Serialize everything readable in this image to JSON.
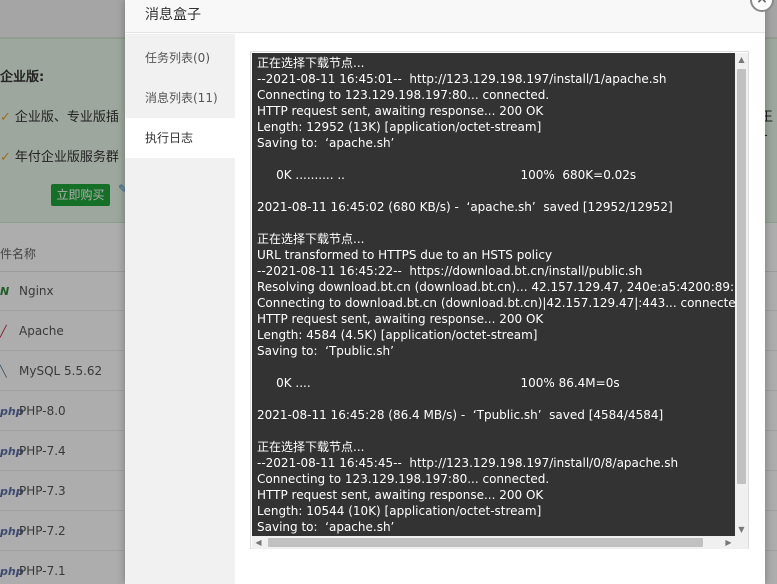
{
  "background": {
    "promo": {
      "title": "企业版:",
      "line1": "企业版、专业版插",
      "line2": "年付企业版服务群",
      "right_fragment": "王1",
      "buy_button": "立即购买"
    },
    "table": {
      "column_header": "件名称",
      "rows": [
        {
          "icon": "nginx-icon",
          "icon_glyph": "N",
          "icon_color": "#2e8b3a",
          "name": "Nginx"
        },
        {
          "icon": "apache-icon",
          "icon_glyph": "╱",
          "icon_color": "#b5223a",
          "name": "Apache"
        },
        {
          "icon": "mysql-icon",
          "icon_glyph": "╲",
          "icon_color": "#5a7f9c",
          "name": "MySQL 5.5.62"
        },
        {
          "icon": "php-icon",
          "icon_glyph": "php",
          "icon_color": "#5a6fa8",
          "name": "PHP-8.0"
        },
        {
          "icon": "php-icon",
          "icon_glyph": "php",
          "icon_color": "#5a6fa8",
          "name": "PHP-7.4"
        },
        {
          "icon": "php-icon",
          "icon_glyph": "php",
          "icon_color": "#5a6fa8",
          "name": "PHP-7.3"
        },
        {
          "icon": "php-icon",
          "icon_glyph": "php",
          "icon_color": "#5a6fa8",
          "name": "PHP-7.2"
        },
        {
          "icon": "php-icon",
          "icon_glyph": "php",
          "icon_color": "#5a6fa8",
          "name": "PHP-7.1"
        }
      ]
    }
  },
  "modal": {
    "title": "消息盒子",
    "close_symbol": "×",
    "tabs": [
      {
        "label": "任务列表(0)",
        "active": false
      },
      {
        "label": "消息列表(11)",
        "active": false
      },
      {
        "label": "执行日志",
        "active": true
      }
    ],
    "log_lines": [
      "正在选择下载节点...",
      "--2021-08-11 16:45:01--  http://123.129.198.197/install/1/apache.sh",
      "Connecting to 123.129.198.197:80... connected.",
      "HTTP request sent, awaiting response... 200 OK",
      "Length: 12952 (13K) [application/octet-stream]",
      "Saving to:  ‘apache.sh’",
      "",
      "     0K .......... ..                                              100%  680K=0.02s",
      "",
      "2021-08-11 16:45:02 (680 KB/s) -  ‘apache.sh’  saved [12952/12952]",
      "",
      "正在选择下载节点...",
      "URL transformed to HTTPS due to an HSTS policy",
      "--2021-08-11 16:45:22--  https://download.bt.cn/install/public.sh",
      "Resolving download.bt.cn (download.bt.cn)... 42.157.129.47, 240e:a5:4200:89::143",
      "Connecting to download.bt.cn (download.bt.cn)|42.157.129.47|:443... connected.",
      "HTTP request sent, awaiting response... 200 OK",
      "Length: 4584 (4.5K) [application/octet-stream]",
      "Saving to:  ‘Tpublic.sh’",
      "",
      "     0K ....                                                       100% 86.4M=0s",
      "",
      "2021-08-11 16:45:28 (86.4 MB/s) -  ‘Tpublic.sh’  saved [4584/4584]",
      "",
      "正在选择下载节点...",
      "--2021-08-11 16:45:45--  http://123.129.198.197/install/0/8/apache.sh",
      "Connecting to 123.129.198.197:80... connected.",
      "HTTP request sent, awaiting response... 200 OK",
      "Length: 10544 (10K) [application/octet-stream]",
      "Saving to:  ‘apache.sh’"
    ],
    "scrollbar": {
      "up_arrow": "▲",
      "down_arrow": "▼",
      "left_arrow": "◀",
      "right_arrow": "▶"
    }
  }
}
